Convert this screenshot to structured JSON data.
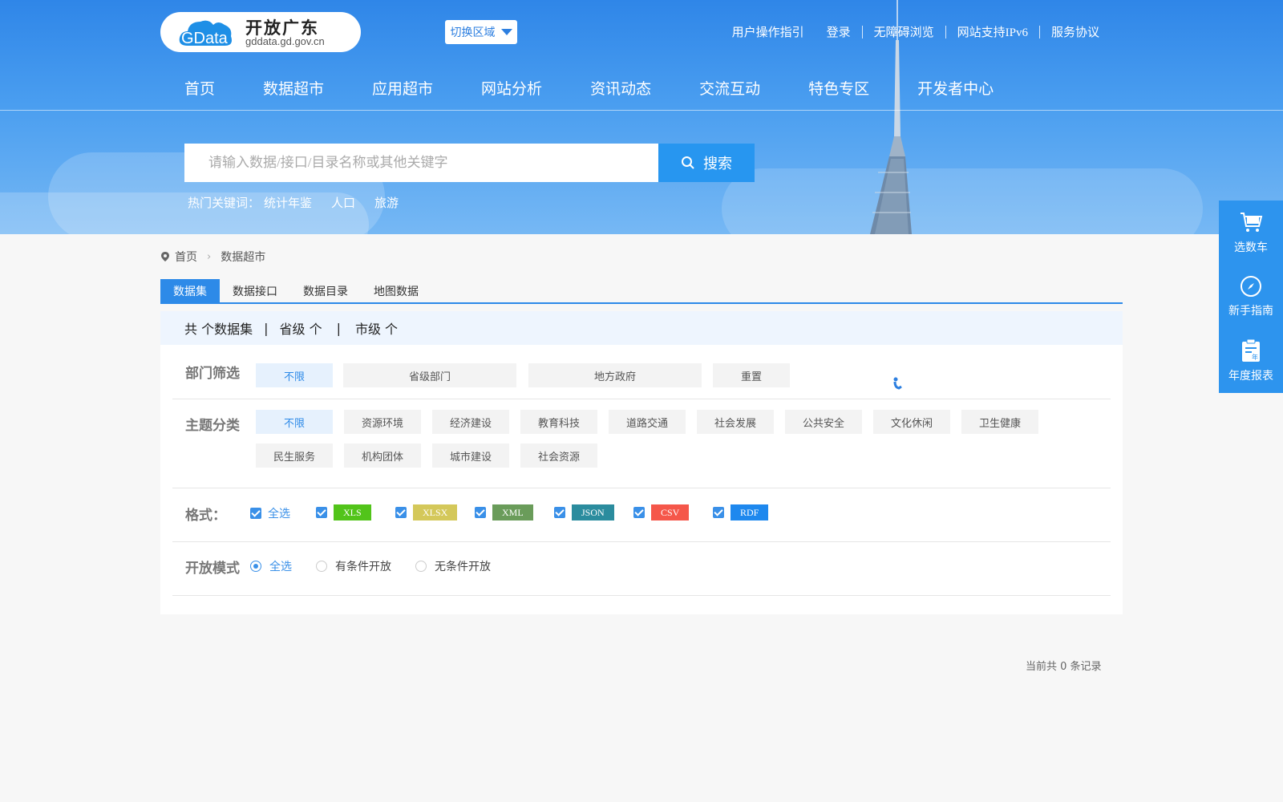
{
  "header": {
    "logo": {
      "badge": "GData",
      "title": "开放广东",
      "url": "gddata.gd.gov.cn"
    },
    "region_switch": "切换区域",
    "top_links": [
      "用户操作指引",
      "登录",
      "无障碍浏览",
      "网站支持IPv6",
      "服务协议"
    ],
    "nav": [
      "首页",
      "数据超市",
      "应用超市",
      "网站分析",
      "资讯动态",
      "交流互动",
      "特色专区",
      "开发者中心"
    ],
    "search": {
      "placeholder": "请输入数据/接口/目录名称或其他关键字",
      "button": "搜索"
    },
    "hot": {
      "label": "热门关键词：",
      "words": [
        "统计年鉴",
        "人口",
        "旅游"
      ]
    }
  },
  "side_float": [
    {
      "icon": "cart-data-icon",
      "label": "选数车"
    },
    {
      "icon": "compass-icon",
      "label": "新手指南"
    },
    {
      "icon": "clipboard-year-icon",
      "label": "年度报表"
    }
  ],
  "breadcrumb": [
    "首页",
    "数据超市"
  ],
  "tabs": [
    "数据集",
    "数据接口",
    "数据目录",
    "地图数据"
  ],
  "summary": {
    "total": "共 个数据集",
    "sep1": "|",
    "province": "省级 个",
    "sep2": "|",
    "city": "市级 个"
  },
  "filters": {
    "department": {
      "label": "部门筛选",
      "options": [
        "不限",
        "省级部门",
        "地方政府",
        "重置"
      ]
    },
    "topic": {
      "label": "主题分类",
      "row1": [
        "不限",
        "资源环境",
        "经济建设",
        "教育科技",
        "道路交通",
        "社会发展",
        "公共安全",
        "文化休闲",
        "卫生健康"
      ],
      "row2": [
        "民生服务",
        "机构团体",
        "城市建设",
        "社会资源"
      ]
    },
    "format": {
      "label": "格式：",
      "all": "全选",
      "items": [
        {
          "name": "XLS",
          "color": "#52c41a"
        },
        {
          "name": "XLSX",
          "color": "#d4c85a"
        },
        {
          "name": "XML",
          "color": "#6a9c5a"
        },
        {
          "name": "JSON",
          "color": "#2b8c9e"
        },
        {
          "name": "CSV",
          "color": "#f5574a"
        },
        {
          "name": "RDF",
          "color": "#1e88ee"
        }
      ]
    },
    "open_mode": {
      "label": "开放模式",
      "options": [
        "全选",
        "有条件开放",
        "无条件开放"
      ]
    }
  },
  "records": "当前共 0 条记录"
}
